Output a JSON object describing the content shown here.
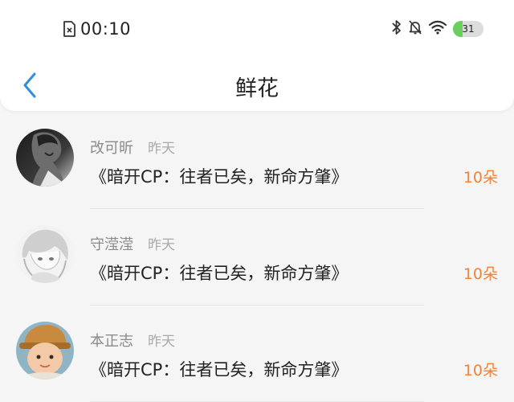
{
  "status_bar": {
    "time": "00:10",
    "battery_level": "31",
    "battery_fraction": 0.31,
    "icons": [
      "sim-card-icon",
      "bluetooth-icon",
      "mute-bell-icon",
      "wifi-icon",
      "battery-icon"
    ]
  },
  "header": {
    "title": "鲜花",
    "back_icon": "chevron-left-icon"
  },
  "colors": {
    "accent": "#2f8fdc",
    "amount": "#f0843a",
    "battery_green": "#6bcf5d"
  },
  "flowers": [
    {
      "user": "改可昕",
      "time": "昨天",
      "book": "《暗开CP：往者已矣，新命方肇》",
      "amount": "10朵"
    },
    {
      "user": "守滢滢",
      "time": "昨天",
      "book": "《暗开CP：往者已矣，新命方肇》",
      "amount": "10朵"
    },
    {
      "user": "本正志",
      "time": "昨天",
      "book": "《暗开CP：往者已矣，新命方肇》",
      "amount": "10朵"
    }
  ]
}
